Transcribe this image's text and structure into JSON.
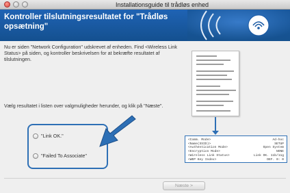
{
  "window": {
    "title": "Installationsguide til trådløs enhed"
  },
  "header": {
    "title": "Kontroller tilslutningsresultatet for \"Trådløs opsætning\""
  },
  "content": {
    "intro_text": "Nu er siden \"Network Configuration\" udskrevet af enheden. Find <Wireless Link Status> på siden, og kontroller beskrivelsen for at bekræfte resultatet af tilslutningen.",
    "instruction_text": "Vælg resultatet i listen over valgmuligheder herunder, og klik på \"Næste\".",
    "options": [
      {
        "label": "\"Link OK.\""
      },
      {
        "label": "\"Failed To Associate\""
      }
    ]
  },
  "report_detail": {
    "rows": [
      [
        "<Comm. Mode>",
        "Ad-hoc"
      ],
      [
        "<Name(SSID)>",
        "SETUP"
      ],
      [
        "<Authentication Mode>",
        "Open System"
      ],
      [
        "<Encryption Mode>",
        "NONE"
      ],
      [
        "<Wireless Link Status>",
        "Link OK. 11b/11g"
      ],
      [
        "<WEP Key Index>",
        "DEF. 0: 0"
      ]
    ]
  },
  "footer": {
    "next_label": "Næste >"
  },
  "colors": {
    "header_bg": "#1a5aa5",
    "accent": "#2d6fb5"
  }
}
